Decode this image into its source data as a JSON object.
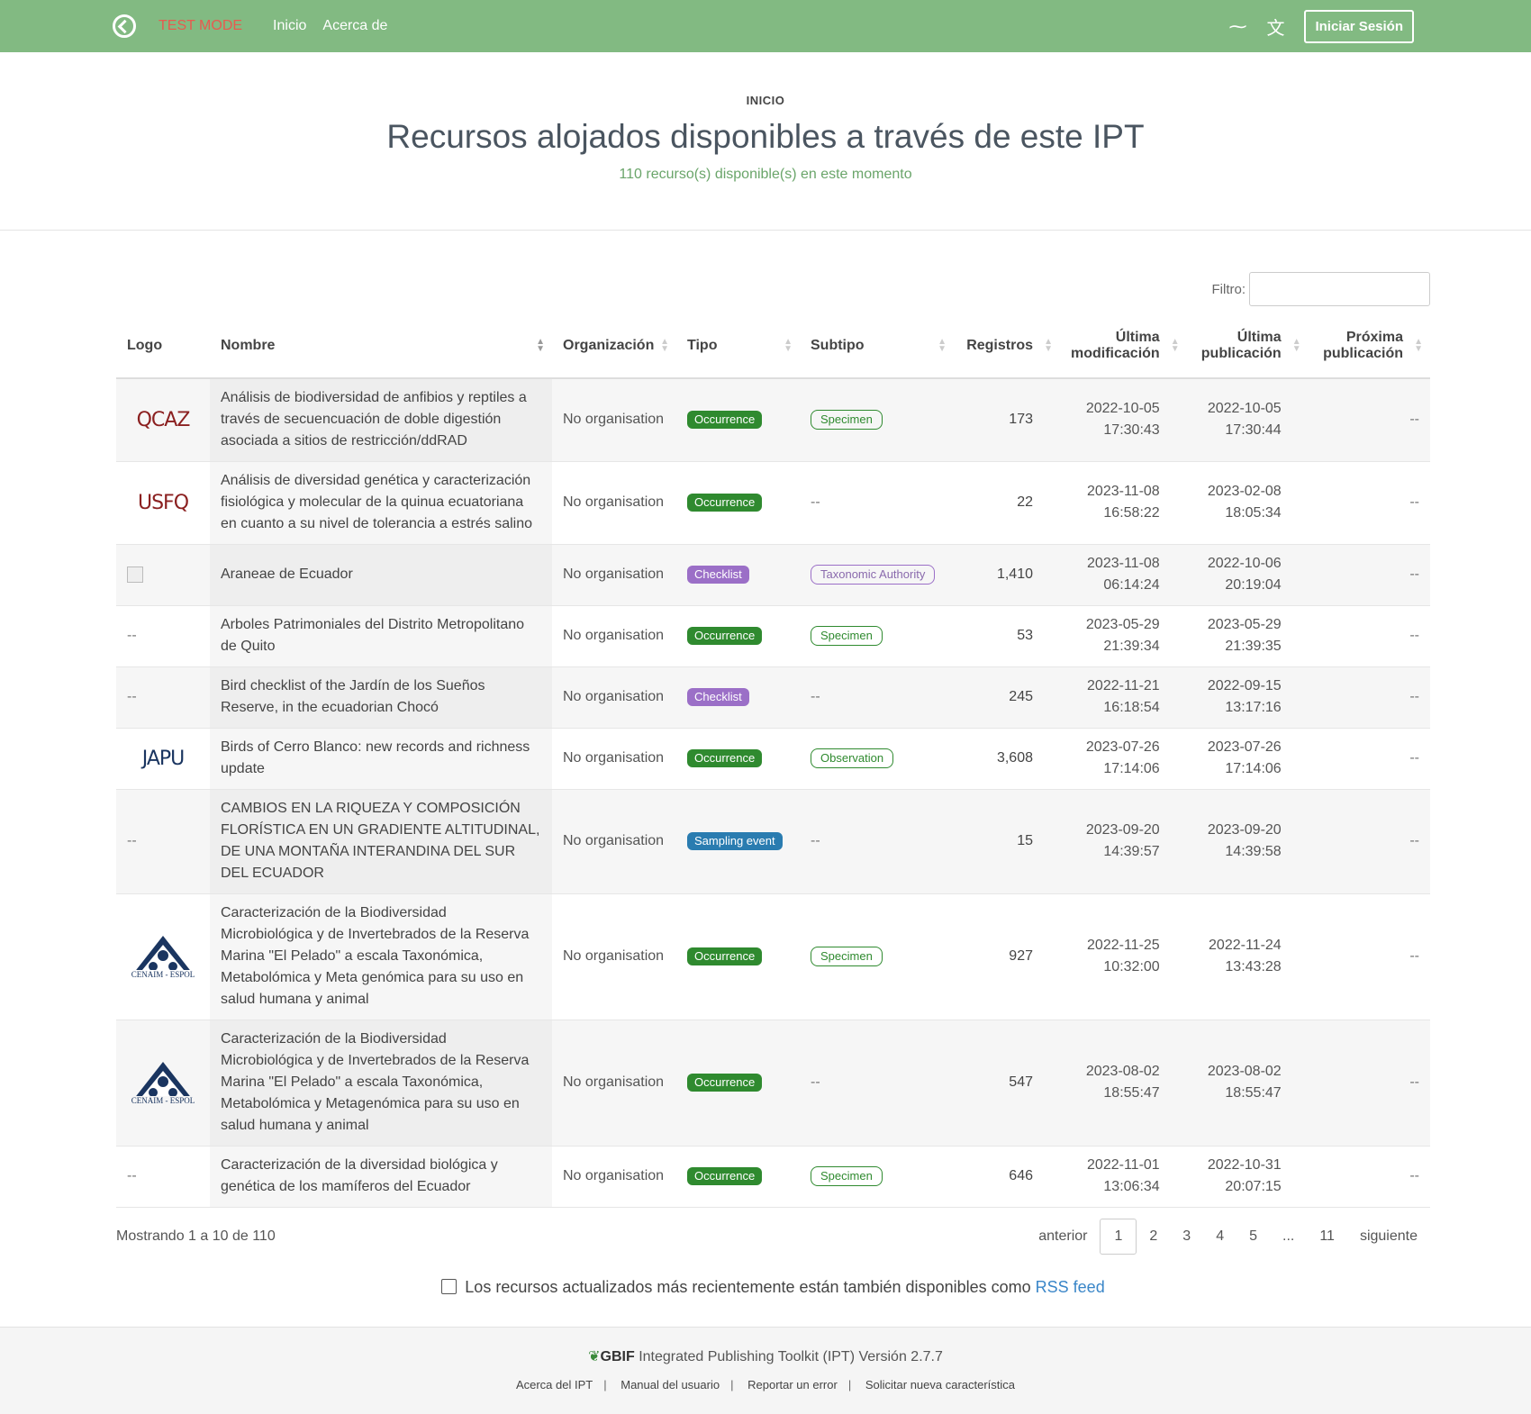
{
  "nav": {
    "test_mode": "TEST MODE",
    "links": [
      "Inicio",
      "Acerca de"
    ],
    "login_label": "Iniciar Sesión"
  },
  "header": {
    "breadcrumb": "INICIO",
    "title": "Recursos alojados disponibles a través de este IPT",
    "subtitle": "110 recurso(s) disponible(s) en este momento"
  },
  "filter": {
    "label": "Filtro:",
    "value": ""
  },
  "table": {
    "headers": {
      "logo": "Logo",
      "name": "Nombre",
      "org": "Organización",
      "type": "Tipo",
      "subtype": "Subtipo",
      "records": "Registros",
      "modified_1": "Última",
      "modified_2": "modificación",
      "published_1": "Última",
      "published_2": "publicación",
      "next_1": "Próxima",
      "next_2": "publicación"
    },
    "rows": [
      {
        "logo": "QCAZ",
        "name": "Análisis de biodiversidad de anfibios y reptiles a través de secuencuación de doble digestión asociada a sitios de restricción/ddRAD",
        "org": "No organisation",
        "type": "Occurrence",
        "subtype": "Specimen",
        "records": "173",
        "mod_date": "2022-10-05",
        "mod_time": "17:30:43",
        "pub_date": "2022-10-05",
        "pub_time": "17:30:44",
        "next": "--"
      },
      {
        "logo": "USFQ",
        "name": "Análisis de diversidad genética y caracterización fisiológica y molecular de la quinua ecuatoriana en cuanto a su nivel de tolerancia a estrés salino",
        "org": "No organisation",
        "type": "Occurrence",
        "subtype": "--",
        "records": "22",
        "mod_date": "2023-11-08",
        "mod_time": "16:58:22",
        "pub_date": "2023-02-08",
        "pub_time": "18:05:34",
        "next": "--"
      },
      {
        "logo": "",
        "name": "Araneae de Ecuador",
        "org": "No organisation",
        "type": "Checklist",
        "subtype": "Taxonomic Authority",
        "records": "1,410",
        "mod_date": "2023-11-08",
        "mod_time": "06:14:24",
        "pub_date": "2022-10-06",
        "pub_time": "20:19:04",
        "next": "--"
      },
      {
        "logo": "--",
        "name": "Arboles Patrimoniales del Distrito Metropolitano de Quito",
        "org": "No organisation",
        "type": "Occurrence",
        "subtype": "Specimen",
        "records": "53",
        "mod_date": "2023-05-29",
        "mod_time": "21:39:34",
        "pub_date": "2023-05-29",
        "pub_time": "21:39:35",
        "next": "--"
      },
      {
        "logo": "--",
        "name": "Bird checklist of the Jardín de los Sueños Reserve, in the ecuadorian Chocó",
        "org": "No organisation",
        "type": "Checklist",
        "subtype": "--",
        "records": "245",
        "mod_date": "2022-11-21",
        "mod_time": "16:18:54",
        "pub_date": "2022-09-15",
        "pub_time": "13:17:16",
        "next": "--"
      },
      {
        "logo": "JAPU",
        "name": "Birds of Cerro Blanco: new records and richness update",
        "org": "No organisation",
        "type": "Occurrence",
        "subtype": "Observation",
        "records": "3,608",
        "mod_date": "2023-07-26",
        "mod_time": "17:14:06",
        "pub_date": "2023-07-26",
        "pub_time": "17:14:06",
        "next": "--"
      },
      {
        "logo": "--",
        "name": "CAMBIOS EN LA RIQUEZA Y COMPOSICIÓN FLORÍSTICA EN UN GRADIENTE ALTITUDINAL, DE UNA MONTAÑA INTERANDINA DEL SUR DEL ECUADOR",
        "org": "No organisation",
        "type": "Sampling event",
        "subtype": "--",
        "records": "15",
        "mod_date": "2023-09-20",
        "mod_time": "14:39:57",
        "pub_date": "2023-09-20",
        "pub_time": "14:39:58",
        "next": "--"
      },
      {
        "logo": "CENAIM - ESPOL",
        "name": "Caracterización de la Biodiversidad Microbiológica y de Invertebrados de la Reserva Marina \"El Pelado\" a escala Taxonómica, Metabolómica y Meta genómica para su uso en salud humana y animal",
        "org": "No organisation",
        "type": "Occurrence",
        "subtype": "Specimen",
        "records": "927",
        "mod_date": "2022-11-25",
        "mod_time": "10:32:00",
        "pub_date": "2022-11-24",
        "pub_time": "13:43:28",
        "next": "--"
      },
      {
        "logo": "CENAIM - ESPOL",
        "name": "Caracterización de la Biodiversidad Microbiológica y de Invertebrados de la Reserva Marina \"El Pelado\" a escala Taxonómica, Metabolómica y Metagenómica para su uso en salud humana y animal",
        "org": "No organisation",
        "type": "Occurrence",
        "subtype": "--",
        "records": "547",
        "mod_date": "2023-08-02",
        "mod_time": "18:55:47",
        "pub_date": "2023-08-02",
        "pub_time": "18:55:47",
        "next": "--"
      },
      {
        "logo": "--",
        "name": "Caracterización de la diversidad biológica y genética de los mamíferos del Ecuador",
        "org": "No organisation",
        "type": "Occurrence",
        "subtype": "Specimen",
        "records": "646",
        "mod_date": "2022-11-01",
        "mod_time": "13:06:34",
        "pub_date": "2022-10-31",
        "pub_time": "20:07:15",
        "next": "--"
      }
    ]
  },
  "pagination": {
    "showing": "Mostrando 1 a 10 de 110",
    "prev": "anterior",
    "pages": [
      "1",
      "2",
      "3",
      "4",
      "5",
      "...",
      "11"
    ],
    "next": "siguiente"
  },
  "rss": {
    "text": "Los recursos actualizados más recientemente están también disponibles como",
    "link": "RSS feed"
  },
  "footer": {
    "gbif": "GBIF",
    "brand": "Integrated Publishing Toolkit (IPT) Versión 2.7.7",
    "links": [
      "Acerca del IPT",
      "Manual del usuario",
      "Reportar un error",
      "Solicitar nueva característica"
    ]
  },
  "colors": {
    "navbar": "#82ba82",
    "occurrence": "#2f8a2f",
    "checklist": "#9b6fc7",
    "sampling_event": "#2a7cb0"
  }
}
